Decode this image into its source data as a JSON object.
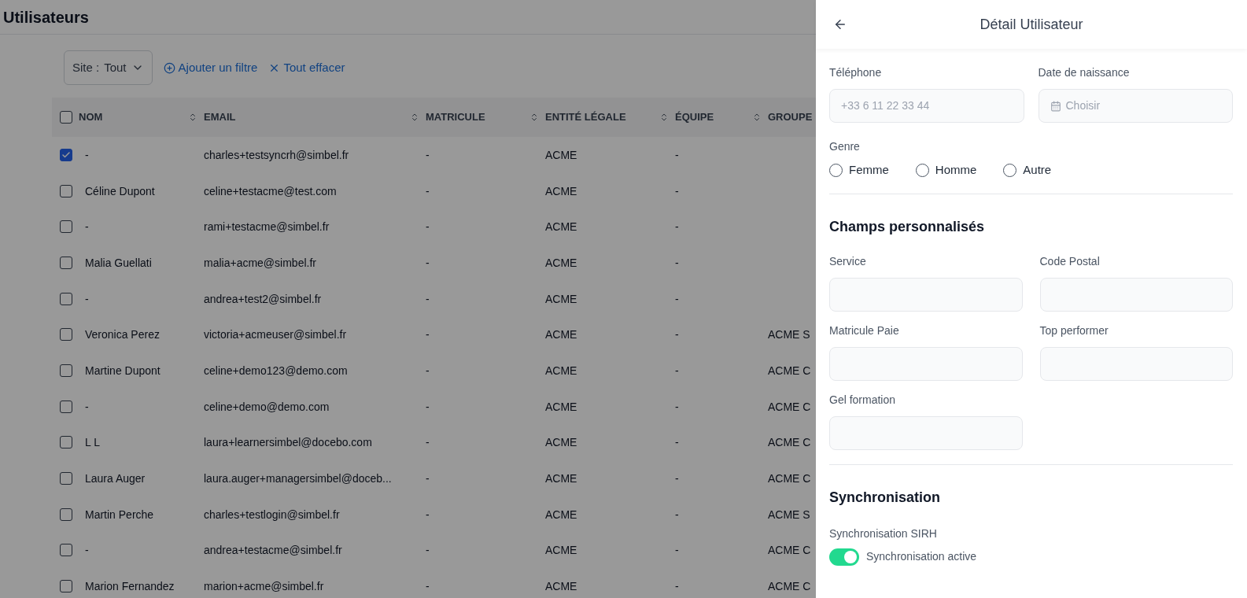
{
  "page": {
    "title": "Utilisateurs"
  },
  "filters": {
    "site": {
      "label": "Site :",
      "value": "Tout"
    },
    "add_filter": "Ajouter un filtre",
    "clear_all": "Tout effacer"
  },
  "table": {
    "select_all_checked": false,
    "columns": [
      {
        "label": "NOM",
        "sortable": true
      },
      {
        "label": "EMAIL",
        "sortable": true
      },
      {
        "label": "MATRICULE",
        "sortable": true
      },
      {
        "label": "ENTITÉ LÉGALE",
        "sortable": true
      },
      {
        "label": "ÉQUIPE",
        "sortable": true
      },
      {
        "label": "GROUPE",
        "sortable": false
      }
    ],
    "rows": [
      {
        "selected": true,
        "cells": [
          "-",
          "charles+testsyncrh@simbel.fr",
          "-",
          "ACME",
          "-",
          ""
        ]
      },
      {
        "selected": false,
        "cells": [
          "Céline Dupont",
          "celine+testacme@test.com",
          "-",
          "ACME",
          "-",
          ""
        ]
      },
      {
        "selected": false,
        "cells": [
          "-",
          "rami+testacme@simbel.fr",
          "-",
          "ACME",
          "-",
          ""
        ]
      },
      {
        "selected": false,
        "cells": [
          "Malia Guellati",
          "malia+acme@simbel.fr",
          "-",
          "ACME",
          "-",
          ""
        ]
      },
      {
        "selected": false,
        "cells": [
          "-",
          "andrea+test2@simbel.fr",
          "-",
          "ACME",
          "-",
          ""
        ]
      },
      {
        "selected": false,
        "cells": [
          "Veronica Perez",
          "victoria+acmeuser@simbel.fr",
          "-",
          "ACME",
          "-",
          "ACME S"
        ]
      },
      {
        "selected": false,
        "cells": [
          "Martine Dupont",
          "celine+demo123@demo.com",
          "-",
          "ACME",
          "-",
          "ACME C"
        ]
      },
      {
        "selected": false,
        "cells": [
          "-",
          "celine+demo@demo.com",
          "-",
          "ACME",
          "-",
          "ACME C"
        ]
      },
      {
        "selected": false,
        "cells": [
          "L L",
          "laura+learnersimbel@docebo.com",
          "-",
          "ACME",
          "-",
          "ACME C"
        ]
      },
      {
        "selected": false,
        "cells": [
          "Laura Auger",
          "laura.auger+managersimbel@doceb...",
          "-",
          "ACME",
          "-",
          "ACME C"
        ]
      },
      {
        "selected": false,
        "cells": [
          "Martin Perche",
          "charles+testlogin@simbel.fr",
          "-",
          "ACME",
          "-",
          "ACME S"
        ]
      },
      {
        "selected": false,
        "cells": [
          "-",
          "andrea+testacme@simbel.fr",
          "-",
          "ACME",
          "-",
          "ACME C"
        ]
      },
      {
        "selected": false,
        "cells": [
          "Marion Fernandez",
          "marion+acme@simbel.fr",
          "-",
          "ACME",
          "-",
          "ACME C"
        ]
      }
    ]
  },
  "drawer": {
    "title": "Détail Utilisateur",
    "contact_fields": [
      {
        "label": "Téléphone",
        "placeholder": "+33 6 11 22 33 44",
        "kind": "text"
      },
      {
        "label": "Date de naissance",
        "placeholder": "Choisir",
        "kind": "date"
      }
    ],
    "gender": {
      "label": "Genre",
      "options": [
        {
          "label": "Femme",
          "selected": false
        },
        {
          "label": "Homme",
          "selected": false
        },
        {
          "label": "Autre",
          "selected": false
        }
      ]
    },
    "custom_section": {
      "title": "Champs personnalisés",
      "fields": [
        {
          "label": "Service"
        },
        {
          "label": "Code Postal"
        },
        {
          "label": "Matricule Paie"
        },
        {
          "label": "Top performer"
        },
        {
          "label": "Gel formation"
        }
      ]
    },
    "sync_section": {
      "title": "Synchronisation",
      "label": "Synchronisation SIRH",
      "toggle": {
        "label": "Synchronisation active",
        "on": true
      }
    }
  }
}
